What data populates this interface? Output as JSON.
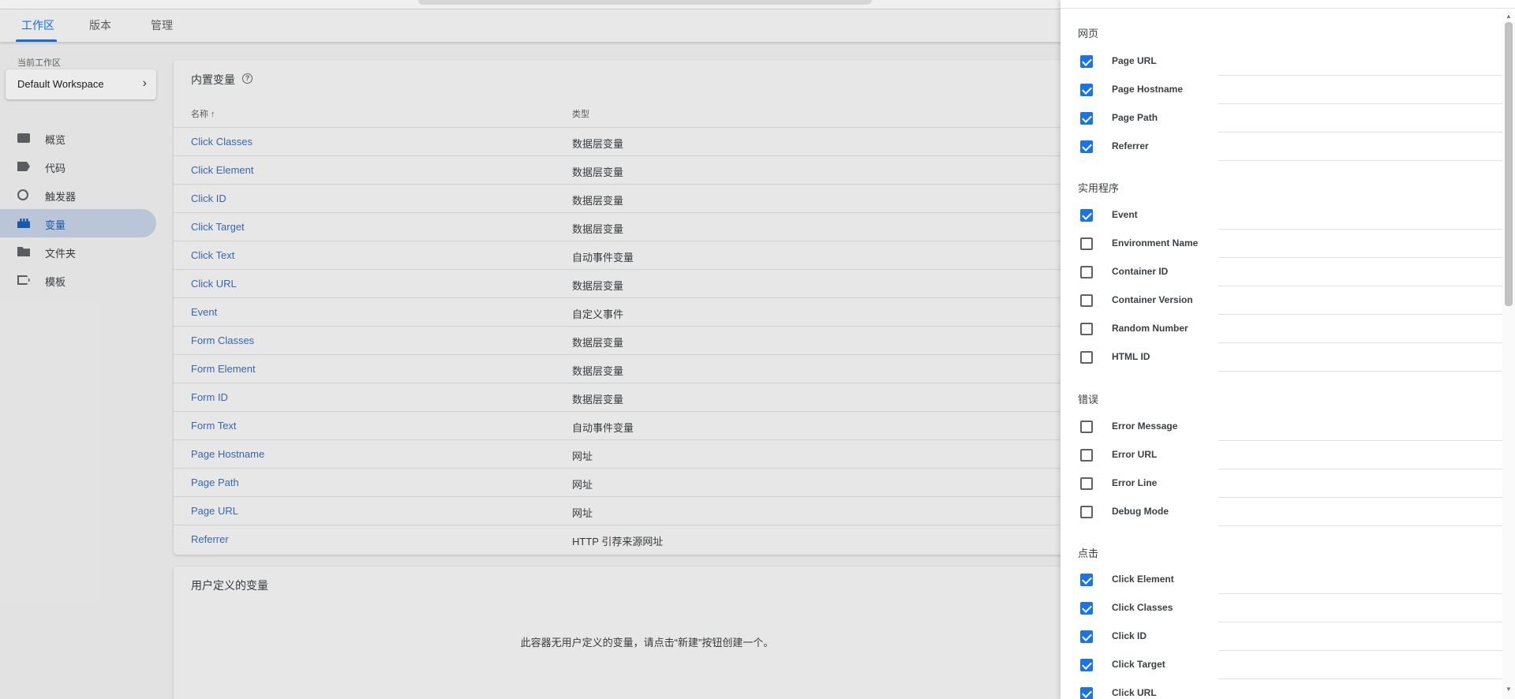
{
  "tabs": [
    {
      "label": "工作区",
      "active": true
    },
    {
      "label": "版本",
      "active": false
    },
    {
      "label": "管理",
      "active": false
    }
  ],
  "workspace": {
    "label": "当前工作区",
    "name": "Default Workspace",
    "chevron": "›"
  },
  "nav": [
    {
      "label": "概览",
      "icon": "overview-icon"
    },
    {
      "label": "代码",
      "icon": "tag-icon"
    },
    {
      "label": "触发器",
      "icon": "trigger-icon"
    },
    {
      "label": "变量",
      "icon": "variables-icon",
      "active": true
    },
    {
      "label": "文件夹",
      "icon": "folder-icon"
    },
    {
      "label": "模板",
      "icon": "template-icon"
    }
  ],
  "builtin": {
    "title": "内置变量",
    "help_icon": "?",
    "col_name": "名称 ↑",
    "col_type": "类型",
    "rows": [
      {
        "name": "Click Classes",
        "type": "数据层变量"
      },
      {
        "name": "Click Element",
        "type": "数据层变量"
      },
      {
        "name": "Click ID",
        "type": "数据层变量"
      },
      {
        "name": "Click Target",
        "type": "数据层变量"
      },
      {
        "name": "Click Text",
        "type": "自动事件变量"
      },
      {
        "name": "Click URL",
        "type": "数据层变量"
      },
      {
        "name": "Event",
        "type": "自定义事件"
      },
      {
        "name": "Form Classes",
        "type": "数据层变量"
      },
      {
        "name": "Form Element",
        "type": "数据层变量"
      },
      {
        "name": "Form ID",
        "type": "数据层变量"
      },
      {
        "name": "Form Text",
        "type": "自动事件变量"
      },
      {
        "name": "Page Hostname",
        "type": "网址"
      },
      {
        "name": "Page Path",
        "type": "网址"
      },
      {
        "name": "Page URL",
        "type": "网址"
      },
      {
        "name": "Referrer",
        "type": "HTTP 引荐来源网址"
      }
    ]
  },
  "user_defined": {
    "title": "用户定义的变量",
    "empty": "此容器无用户定义的变量，请点击“新建”按钮创建一个。"
  },
  "panel": {
    "sections": [
      {
        "title": "网页",
        "items": [
          {
            "label": "Page URL",
            "checked": true
          },
          {
            "label": "Page Hostname",
            "checked": true
          },
          {
            "label": "Page Path",
            "checked": true
          },
          {
            "label": "Referrer",
            "checked": true
          }
        ]
      },
      {
        "title": "实用程序",
        "items": [
          {
            "label": "Event",
            "checked": true
          },
          {
            "label": "Environment Name",
            "checked": false
          },
          {
            "label": "Container ID",
            "checked": false
          },
          {
            "label": "Container Version",
            "checked": false
          },
          {
            "label": "Random Number",
            "checked": false
          },
          {
            "label": "HTML ID",
            "checked": false
          }
        ]
      },
      {
        "title": "错误",
        "items": [
          {
            "label": "Error Message",
            "checked": false
          },
          {
            "label": "Error URL",
            "checked": false
          },
          {
            "label": "Error Line",
            "checked": false
          },
          {
            "label": "Debug Mode",
            "checked": false
          }
        ]
      },
      {
        "title": "点击",
        "items": [
          {
            "label": "Click Element",
            "checked": true
          },
          {
            "label": "Click Classes",
            "checked": true
          },
          {
            "label": "Click ID",
            "checked": true
          },
          {
            "label": "Click Target",
            "checked": true
          },
          {
            "label": "Click URL",
            "checked": true
          }
        ]
      }
    ]
  }
}
